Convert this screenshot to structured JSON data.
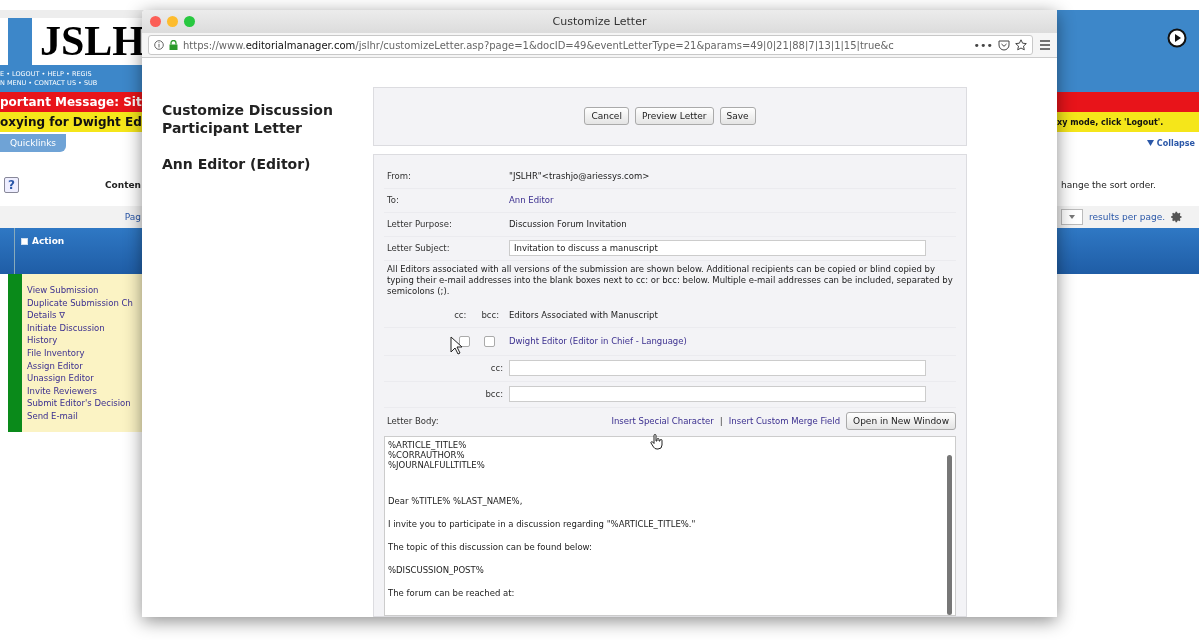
{
  "background_page": {
    "logo": "JSLH",
    "nav_lines": [
      "E • LOGOUT • HELP • REGIS",
      "N MENU • CONTACT US • SUB"
    ],
    "alert": "portant Message: Sit",
    "proxy_left": "oxying for Dwight Ed",
    "proxy_right": "xy mode, click 'Logout'.",
    "quicklinks": "Quicklinks",
    "help": "?",
    "content_heading": "Conten",
    "page_label": "Pag",
    "collapse": "Collapse",
    "sort_hint": "hange the sort order.",
    "per_page": "results per page.",
    "action_header": "Action",
    "actions": [
      "View Submission",
      "Duplicate Submission Ch",
      "Details ∇",
      "Initiate Discussion",
      "History",
      "File Inventory",
      "Assign Editor",
      "Unassign Editor",
      "Invite Reviewers",
      "Submit Editor's Decision",
      "Send E-mail"
    ]
  },
  "window": {
    "title": "Customize Letter",
    "url": "https://www.**editorialmanager.com**/jslhr/customizeLetter.asp?page=1&docID=49&eventLetterType=21&params=49|0|21|88|7|13|1|15|true&c",
    "more": "•••"
  },
  "page": {
    "heading": "Customize Discussion Participant Letter",
    "recipient": "Ann Editor (Editor)"
  },
  "buttons": [
    "Cancel",
    "Preview Letter",
    "Save"
  ],
  "fields": [
    {
      "label": "From:",
      "value": "\"JSLHR\"<trashjo@ariessys.com>",
      "kind": "text"
    },
    {
      "label": "To:",
      "value": "Ann Editor",
      "kind": "link"
    },
    {
      "label": "Letter Purpose:",
      "value": "Discussion Forum Invitation",
      "kind": "text"
    },
    {
      "label": "Letter Subject:",
      "value": "Invitation to discuss a manuscript",
      "kind": "input"
    }
  ],
  "note": "All Editors associated with all versions of the submission are shown below. Additional recipients can be copied or blind copied by typing their e-mail addresses into the blank boxes next to cc: or bcc: below. Multiple e-mail addresses can be included, separated by semicolons (;).",
  "recipients_header": {
    "cc": "cc:",
    "bcc": "bcc:",
    "title": "Editors Associated with Manuscript"
  },
  "editors": [
    {
      "name": "Dwight Editor (Editor in Chief - Language)",
      "cc": false,
      "bcc": false
    }
  ],
  "copy_fields": [
    {
      "label": "cc:"
    },
    {
      "label": "bcc:"
    }
  ],
  "letter_body": {
    "label": "Letter Body:",
    "links": [
      "Insert Special Character",
      "Insert Custom Merge Field"
    ],
    "separator": "|",
    "open_button": "Open in New Window",
    "paragraphs": [
      {
        "lines": [
          "%ARTICLE_TITLE%",
          "%CORRAUTHOR%",
          "%JOURNALFULLTITLE%"
        ]
      },
      {
        "lines": [
          "Dear %TITLE% %LAST_NAME%,"
        ]
      },
      {
        "lines": [
          "I invite you to participate in a discussion regarding \"%ARTICLE_TITLE%.\""
        ]
      },
      {
        "lines": [
          "The topic of this discussion can be found below:"
        ]
      },
      {
        "lines": [
          "%DISCUSSION_POST%"
        ]
      },
      {
        "lines": [
          "The forum can be reached at:"
        ]
      }
    ]
  }
}
